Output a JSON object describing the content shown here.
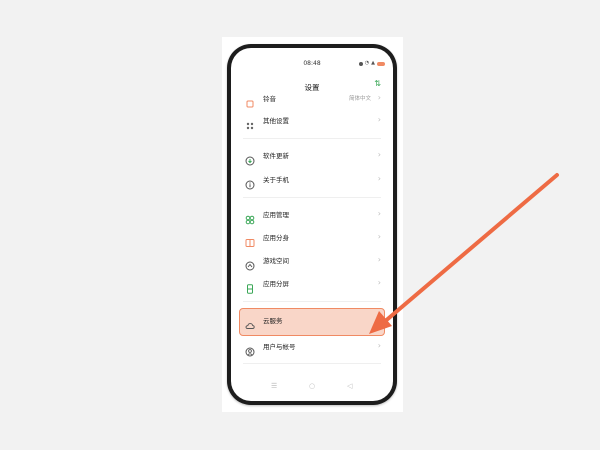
{
  "status_bar": {
    "time": "08:48",
    "battery_color": "#f08a63"
  },
  "header": {
    "title": "设置",
    "sort_icon": "sort-arrows-icon"
  },
  "settings": {
    "sound": {
      "label": "铃音",
      "value": "简体中文"
    },
    "other": {
      "label": "其他设置"
    },
    "update": {
      "label": "软件更新"
    },
    "about": {
      "label": "关于手机"
    },
    "app_manage": {
      "label": "应用管理"
    },
    "app_clone": {
      "label": "应用分身"
    },
    "game_space": {
      "label": "游戏空间"
    },
    "split_screen": {
      "label": "应用分屏"
    },
    "cloud": {
      "label": "云服务"
    },
    "account": {
      "label": "用户与帐号"
    }
  },
  "colors": {
    "accent": "#3aa757",
    "highlight": "#f9d6c8",
    "arrow": "#ee6b44"
  },
  "nav": {
    "menu": "menu-icon",
    "home": "home-icon",
    "back": "back-icon"
  }
}
